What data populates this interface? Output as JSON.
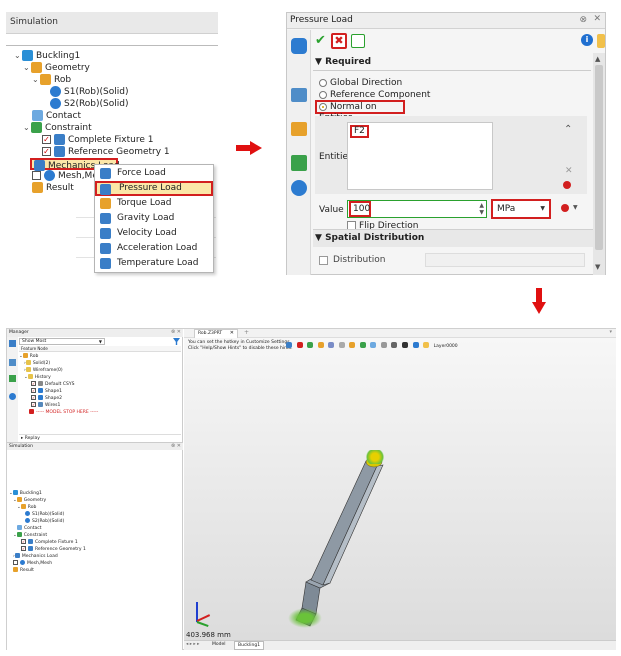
{
  "top_sim": {
    "title": "Simulation",
    "tree": {
      "root": "Buckling1",
      "geometry": "Geometry",
      "rod": "Rob",
      "solid": "S1(Rob)(Solid)",
      "solid2": "S2(Rob)(Solid)",
      "contact": "Contact",
      "constraint": "Constraint",
      "fixture": "Complete Fixture 1",
      "refgeo": "Reference Geometry 1",
      "mech": "Mechanics Load",
      "mesh": "Mesh,Mesh",
      "result": "Result"
    },
    "menu": [
      "Force Load",
      "Pressure Load",
      "Torque Load",
      "Gravity Load",
      "Velocity Load",
      "Acceleration Load",
      "Temperature Load"
    ]
  },
  "pressure": {
    "title": "Pressure Load",
    "required": "Required",
    "opt1": "Global Direction",
    "opt2": "Reference Component",
    "opt3": "Normal on Entities",
    "entity": "F2",
    "entities_label": "Entities",
    "value_label": "Value",
    "value": "100",
    "unit": "MPa",
    "flip": "Flip Direction",
    "spatial": "Spatial Distribution",
    "distribution": "Distribution"
  },
  "bottom": {
    "manager_title": "Manager",
    "show_most": "Show Most",
    "feature_node": "Feature Node",
    "mgr": {
      "rob": "Rob",
      "solid": "Solid(2)",
      "wire": "Wireframe(0)",
      "history": "History",
      "csys": "Default CSYS",
      "shape1": "Shape1",
      "shape2": "Shape2",
      "wires": "Wires1",
      "stop": "----- MODEL STOP HERE -----"
    },
    "replay": "Replay",
    "sim_title": "Simulation",
    "tab": "Rob.Z3PRT",
    "hint1": "You can set the hotkey in Customize Settings.",
    "hint2": "Click \"Help/Show Hints\" to disable these hints.",
    "layer": "Layer0000",
    "scale": "403.968 mm",
    "tab_model": "Model",
    "tab_buckling": "Buckling1"
  }
}
